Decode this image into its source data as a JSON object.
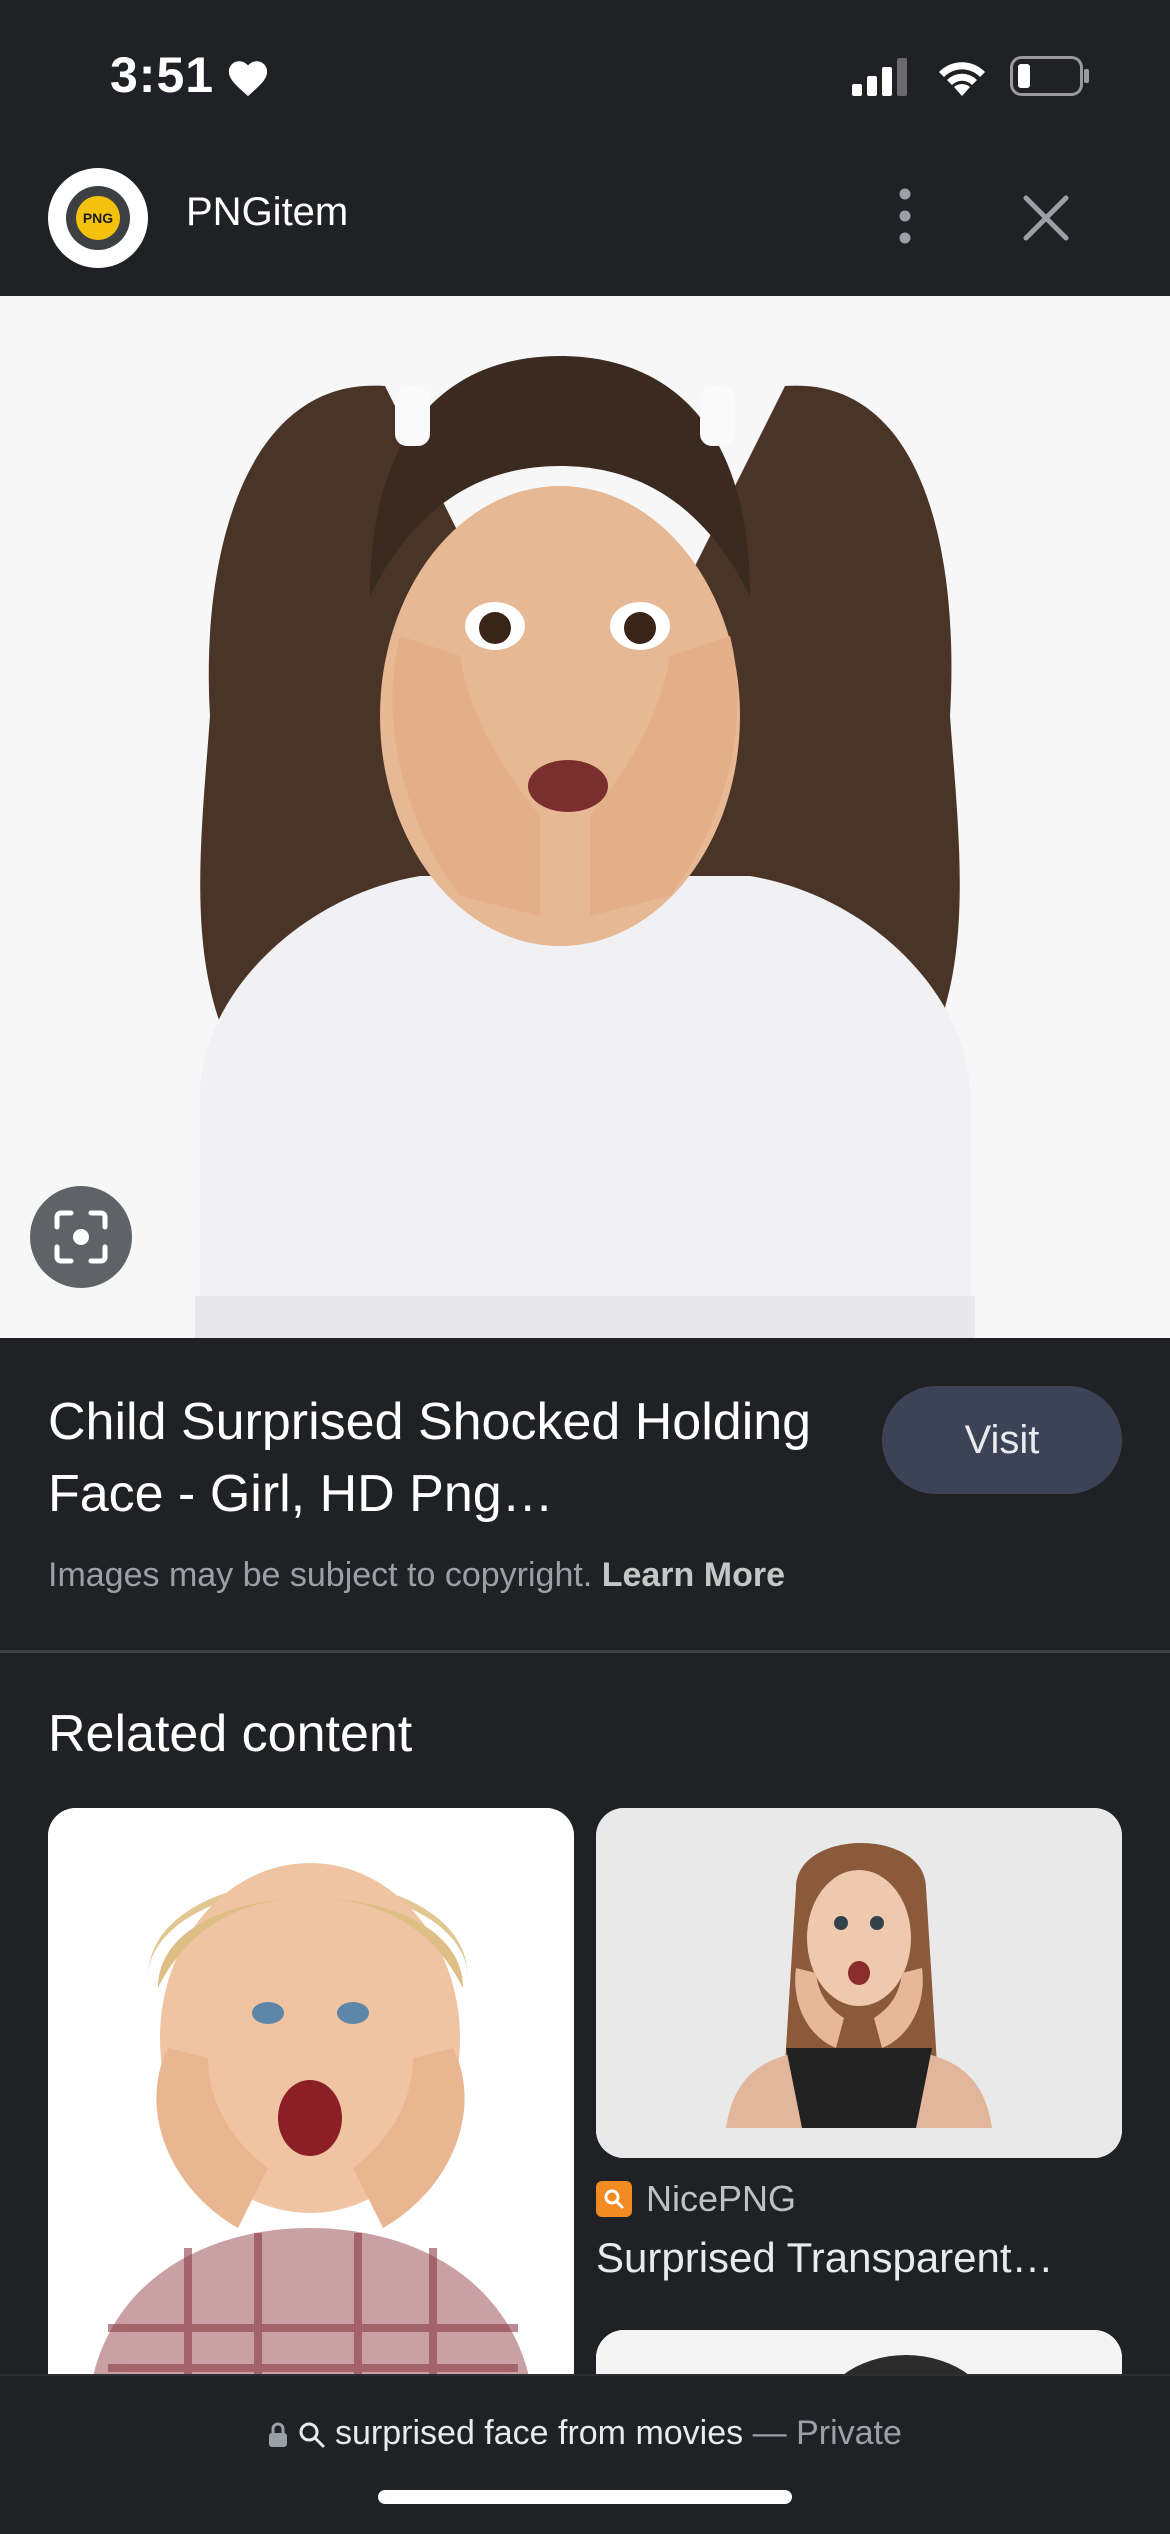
{
  "status_bar": {
    "time": "3:51"
  },
  "header": {
    "site_name": "PNGitem",
    "logo_text": "PNG"
  },
  "result": {
    "title": "Child Surprised Shocked Holding Face - Girl, HD Png…",
    "visit_label": "Visit",
    "copyright_text": "Images may be subject to copyright.",
    "learn_more": "Learn More"
  },
  "related": {
    "heading": "Related content",
    "cards": [
      {
        "source": "",
        "title": ""
      },
      {
        "source": "NicePNG",
        "title": "Surprised Transparent…"
      }
    ]
  },
  "address_bar": {
    "query": "surprised face from movies",
    "separator": "—",
    "mode": "Private"
  },
  "colors": {
    "background": "#202124",
    "visit_button": "#3c4356",
    "accent_source": "#f28b22"
  }
}
